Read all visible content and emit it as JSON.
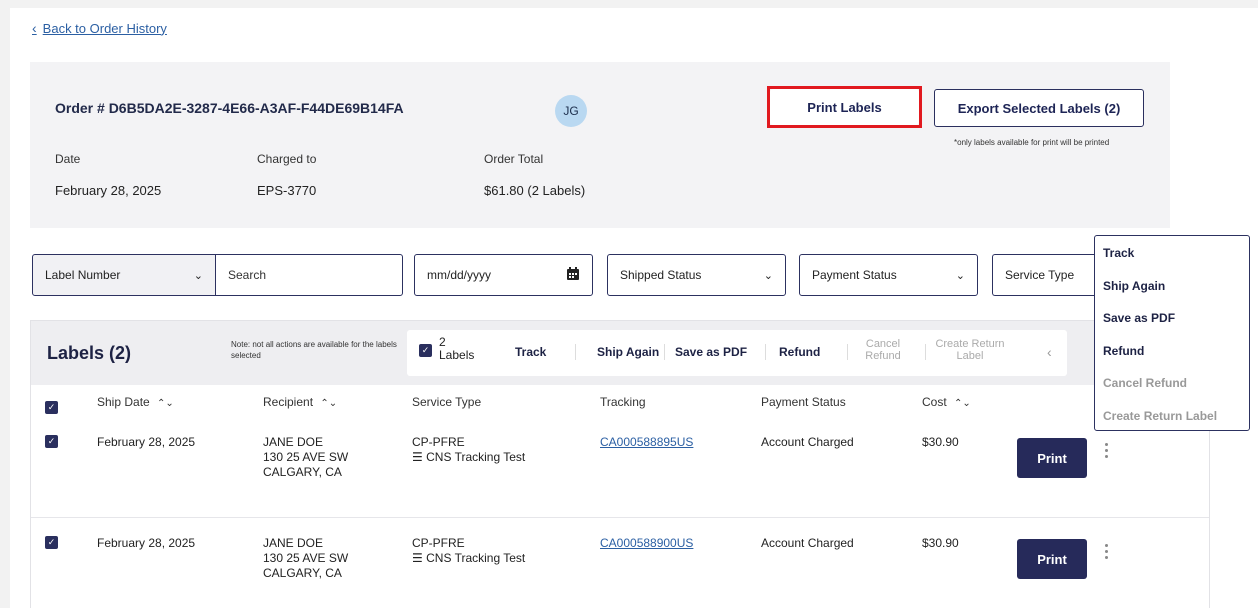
{
  "nav": {
    "back_label": "Back to Order History"
  },
  "order": {
    "title": "Order # D6B5DA2E-3287-4E66-A3AF-F44DE69B14FA",
    "avatar_initials": "JG",
    "print_labels_label": "Print Labels",
    "export_label": "Export Selected Labels (2)",
    "print_note": "*only labels available for print will be printed",
    "date_label": "Date",
    "date_value": "February 28, 2025",
    "charged_label": "Charged to",
    "charged_value": "EPS-3770",
    "total_label": "Order Total",
    "total_value": "$61.80 (2 Labels)"
  },
  "filters": {
    "label_number": "Label Number",
    "search_placeholder": "Search",
    "date_placeholder": "mm/dd/yyyy",
    "shipped_status": "Shipped Status",
    "payment_status": "Payment Status",
    "service_type": "Service Type"
  },
  "labels": {
    "title": "Labels (2)",
    "note": "Note: not all actions are available for the labels selected",
    "selected_count": "2",
    "selected_word": "Labels",
    "actions": {
      "track": "Track",
      "ship_again": "Ship Again",
      "save_pdf": "Save as PDF",
      "refund": "Refund",
      "cancel_refund": "Cancel Refund",
      "create_return": "Create Return Label"
    },
    "columns": {
      "ship_date": "Ship Date",
      "recipient": "Recipient",
      "service_type": "Service Type",
      "tracking": "Tracking",
      "payment_status": "Payment Status",
      "cost": "Cost"
    },
    "rows": [
      {
        "ship_date": "February 28, 2025",
        "name": "JANE DOE",
        "address1": "130 25 AVE SW",
        "address2": "CALGARY, CA",
        "service": "CP-PFRE",
        "service_sub": "CNS Tracking Test",
        "tracking": "CA000588895US",
        "payment": "Account Charged",
        "cost": "$30.90",
        "print_label": "Print"
      },
      {
        "ship_date": "February 28, 2025",
        "name": "JANE DOE",
        "address1": "130 25 AVE SW",
        "address2": "CALGARY, CA",
        "service": "CP-PFRE",
        "service_sub": "CNS Tracking Test",
        "tracking": "CA000588900US",
        "payment": "Account Charged",
        "cost": "$30.90",
        "print_label": "Print"
      }
    ]
  },
  "menu": {
    "items": [
      "Track",
      "Ship Again",
      "Save as PDF",
      "Refund",
      "Cancel Refund",
      "Create Return Label"
    ]
  },
  "colors": {
    "accent": "#262a5a",
    "link": "#2b5fa3",
    "highlight": "#e1191f"
  }
}
